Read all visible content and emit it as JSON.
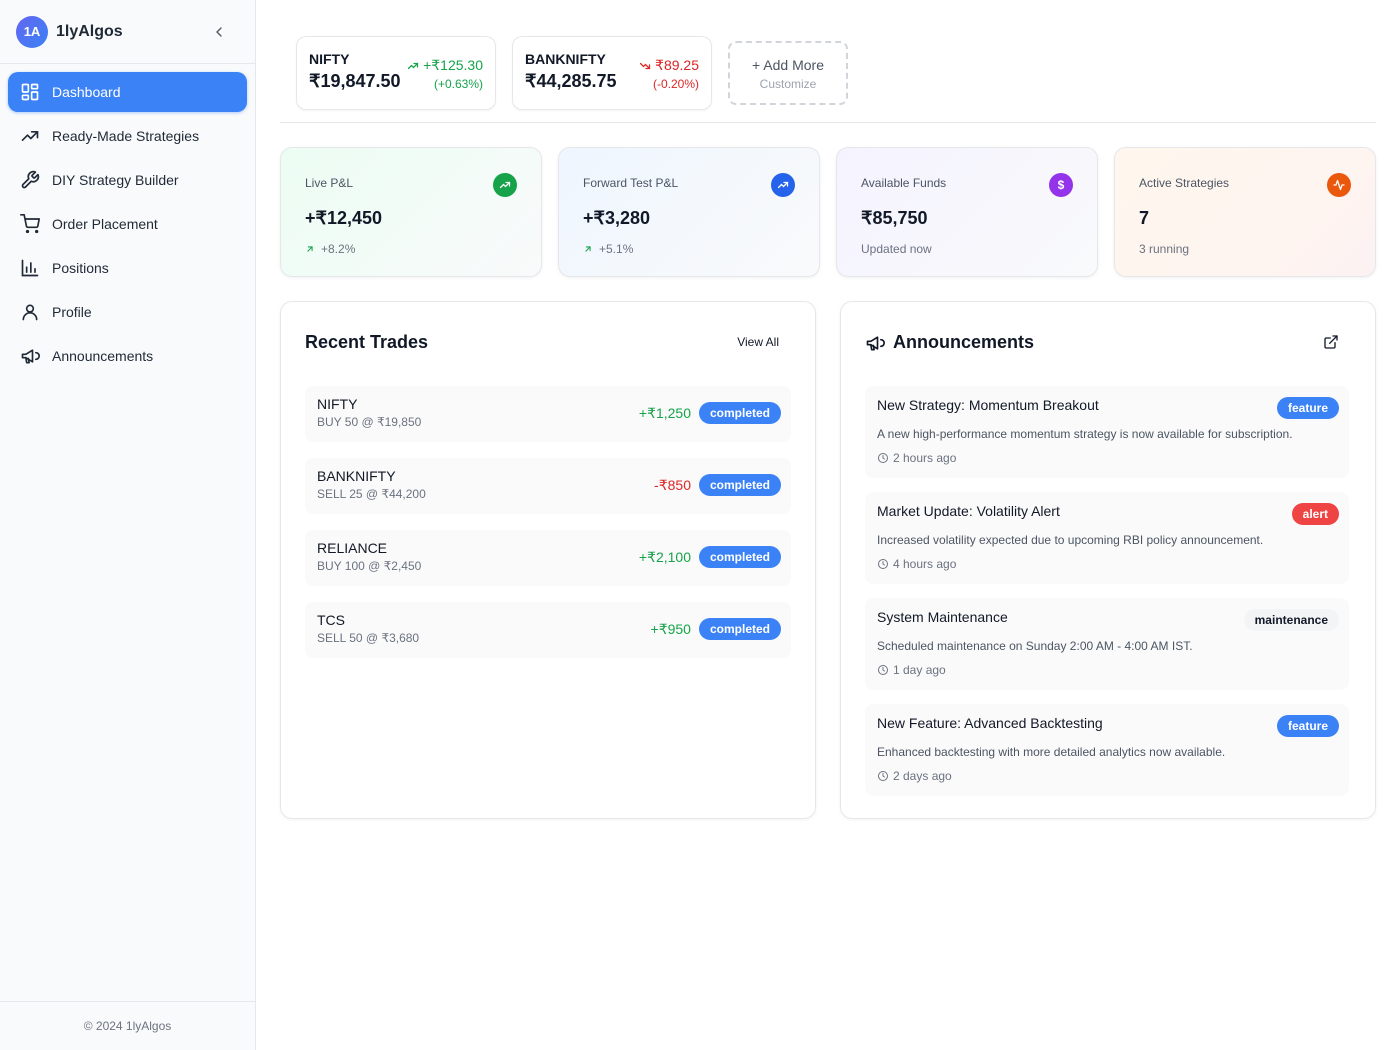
{
  "brand": {
    "logo": "1A",
    "name": "1lyAlgos"
  },
  "nav": [
    {
      "label": "Dashboard",
      "icon": "dashboard-icon",
      "active": true
    },
    {
      "label": "Ready-Made Strategies",
      "icon": "trending-up-icon"
    },
    {
      "label": "DIY Strategy Builder",
      "icon": "wrench-icon"
    },
    {
      "label": "Order Placement",
      "icon": "cart-icon"
    },
    {
      "label": "Positions",
      "icon": "bar-chart-icon"
    },
    {
      "label": "Profile",
      "icon": "user-icon"
    },
    {
      "label": "Announcements",
      "icon": "megaphone-icon"
    }
  ],
  "footer": "© 2024 1lyAlgos",
  "tickers": [
    {
      "name": "NIFTY",
      "price": "₹19,847.50",
      "change": "+₹125.30",
      "pct": "(+0.63%)",
      "direction": "up"
    },
    {
      "name": "BANKNIFTY",
      "price": "₹44,285.75",
      "change": "₹89.25",
      "pct": "(-0.20%)",
      "direction": "down"
    }
  ],
  "add_more": {
    "label": "+ Add More",
    "sub": "Customize"
  },
  "stats": [
    {
      "label": "Live P&L",
      "value": "+₹12,450",
      "sub": "+8.2%",
      "icon": "trending-up-icon",
      "color": "#16a34a"
    },
    {
      "label": "Forward Test P&L",
      "value": "+₹3,280",
      "sub": "+5.1%",
      "icon": "trending-up-icon",
      "color": "#2563eb"
    },
    {
      "label": "Available Funds",
      "value": "₹85,750",
      "sub": "Updated now",
      "icon": "dollar-icon",
      "color": "#9333ea"
    },
    {
      "label": "Active Strategies",
      "value": "7",
      "sub": "3 running",
      "icon": "activity-icon",
      "color": "#ea580c"
    }
  ],
  "recent_trades": {
    "title": "Recent Trades",
    "view_all": "View All",
    "rows": [
      {
        "symbol": "NIFTY",
        "meta": "BUY 50 @ ₹19,850",
        "pnl": "+₹1,250",
        "status": "completed",
        "direction": "up"
      },
      {
        "symbol": "BANKNIFTY",
        "meta": "SELL 25 @ ₹44,200",
        "pnl": "-₹850",
        "status": "completed",
        "direction": "down"
      },
      {
        "symbol": "RELIANCE",
        "meta": "BUY 100 @ ₹2,450",
        "pnl": "+₹2,100",
        "status": "completed",
        "direction": "up"
      },
      {
        "symbol": "TCS",
        "meta": "SELL 50 @ ₹3,680",
        "pnl": "+₹950",
        "status": "completed",
        "direction": "up"
      }
    ]
  },
  "announcements": {
    "title": "Announcements",
    "items": [
      {
        "title": "New Strategy: Momentum Breakout",
        "desc": "A new high-performance momentum strategy is now available for subscription.",
        "time": "2 hours ago",
        "tag": "feature"
      },
      {
        "title": "Market Update: Volatility Alert",
        "desc": "Increased volatility expected due to upcoming RBI policy announcement.",
        "time": "4 hours ago",
        "tag": "alert"
      },
      {
        "title": "System Maintenance",
        "desc": "Scheduled maintenance on Sunday 2:00 AM - 4:00 AM IST.",
        "time": "1 day ago",
        "tag": "maintenance"
      },
      {
        "title": "New Feature: Advanced Backtesting",
        "desc": "Enhanced backtesting with more detailed analytics now available.",
        "time": "2 days ago",
        "tag": "feature"
      }
    ]
  },
  "colors": {
    "accent": "#3b82f6",
    "up": "#16a34a",
    "down": "#dc2626"
  }
}
